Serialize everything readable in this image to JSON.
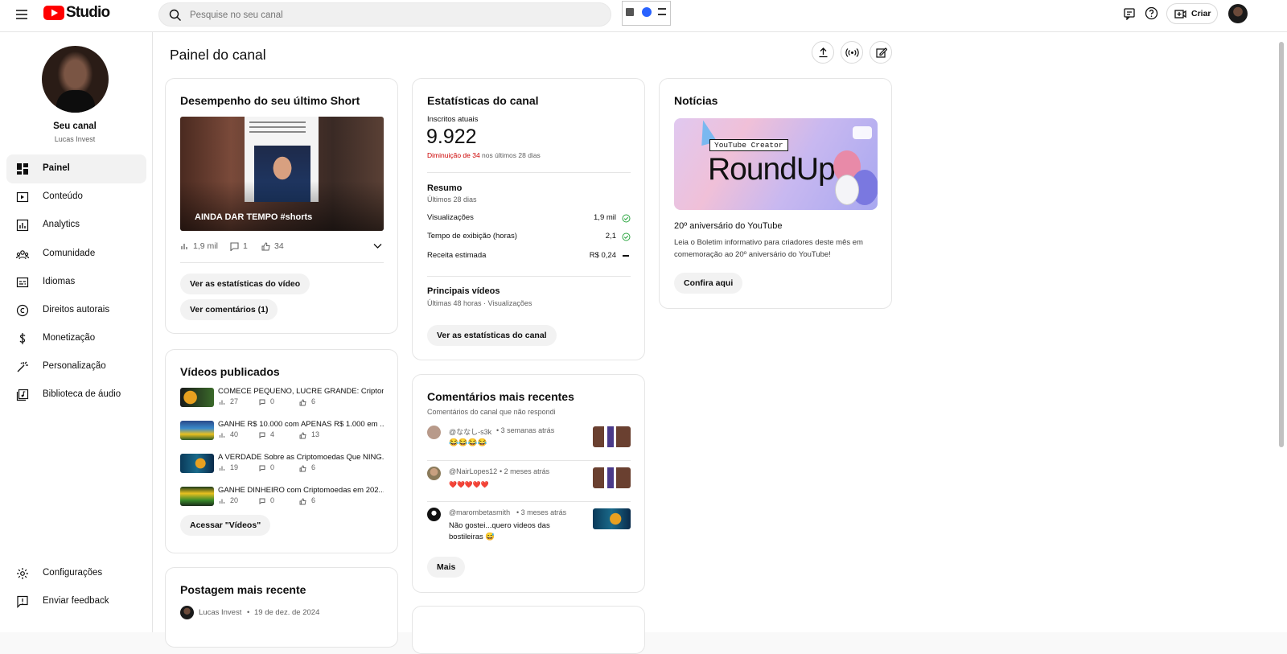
{
  "app": {
    "logo_text": "Studio"
  },
  "search": {
    "placeholder": "Pesquise no seu canal"
  },
  "header": {
    "create_label": "Criar"
  },
  "channel": {
    "title": "Seu canal",
    "name": "Lucas Invest"
  },
  "sidebar": {
    "items": [
      {
        "label": "Painel",
        "icon": "dashboard-icon"
      },
      {
        "label": "Conteúdo",
        "icon": "content-icon"
      },
      {
        "label": "Analytics",
        "icon": "analytics-icon"
      },
      {
        "label": "Comunidade",
        "icon": "community-icon"
      },
      {
        "label": "Idiomas",
        "icon": "subtitles-icon"
      },
      {
        "label": "Direitos autorais",
        "icon": "copyright-icon"
      },
      {
        "label": "Monetização",
        "icon": "dollar-icon"
      },
      {
        "label": "Personalização",
        "icon": "magic-wand-icon"
      },
      {
        "label": "Biblioteca de áudio",
        "icon": "audio-library-icon"
      }
    ],
    "bottom": [
      {
        "label": "Configurações",
        "icon": "gear-icon"
      },
      {
        "label": "Enviar feedback",
        "icon": "feedback-icon"
      }
    ]
  },
  "page": {
    "title": "Painel do canal"
  },
  "short_card": {
    "title": "Desempenho do seu último Short",
    "video_title": "AINDA DAR TEMPO #shorts",
    "views": "1,9 mil",
    "comments": "1",
    "likes": "34",
    "stats_button": "Ver as estatísticas do vídeo",
    "comments_button": "Ver comentários (1)"
  },
  "published": {
    "title": "Vídeos publicados",
    "videos": [
      {
        "title": "COMECE PEQUENO, LUCRE GRANDE: Criptom...",
        "views": "27",
        "comments": "0",
        "likes": "6"
      },
      {
        "title": "GANHE R$ 10.000 com APENAS R$ 1.000 em ...",
        "views": "40",
        "comments": "4",
        "likes": "13"
      },
      {
        "title": "A VERDADE Sobre as Criptomoedas Que NING...",
        "views": "19",
        "comments": "0",
        "likes": "6"
      },
      {
        "title": "GANHE DINHEIRO com Criptomoedas em 202...",
        "views": "20",
        "comments": "0",
        "likes": "6"
      }
    ],
    "button": "Acessar \"Vídeos\""
  },
  "recent_post": {
    "title": "Postagem mais recente",
    "author": "Lucas Invest",
    "date": "19 de dez. de 2024"
  },
  "stats": {
    "title": "Estatísticas do canal",
    "subs_label": "Inscritos atuais",
    "subs_value": "9.922",
    "change_red": "Diminuição de 34",
    "change_rest": " nos últimos 28 dias",
    "summary_title": "Resumo",
    "summary_sub": "Últimos 28 dias",
    "rows": [
      {
        "label": "Visualizações",
        "value": "1,9 mil"
      },
      {
        "label": "Tempo de exibição (horas)",
        "value": "2,1"
      },
      {
        "label": "Receita estimada",
        "value": "R$ 0,24"
      }
    ],
    "top_title": "Principais vídeos",
    "top_sub": "Últimas 48 horas · Visualizações",
    "button": "Ver as estatísticas do canal"
  },
  "comments": {
    "title": "Comentários mais recentes",
    "subtitle": "Comentários do canal que não respondi",
    "items": [
      {
        "author": "@ななし-s3k",
        "time": "3 semanas atrás",
        "text": "😂😂😂😂"
      },
      {
        "author": "@NairLopes12",
        "time": "2 meses atrás",
        "text": "❤️❤️❤️❤️❤️"
      },
      {
        "author": "@marombetasmith",
        "time": "3 meses atrás",
        "text": "Não gostei...quero videos das bostileiras 😅"
      }
    ],
    "more": "Mais"
  },
  "news": {
    "title": "Notícias",
    "banner_tag": "YouTube Creator",
    "banner_word": "RoundUp",
    "headline": "20º aniversário do YouTube",
    "body": "Leia o Boletim informativo para criadores deste mês em comemoração ao 20º aniversário do YouTube!",
    "button": "Confira aqui"
  },
  "colors": {
    "accent": "#ff0000",
    "red_text": "#cc0000",
    "green_check": "#2ba640"
  }
}
